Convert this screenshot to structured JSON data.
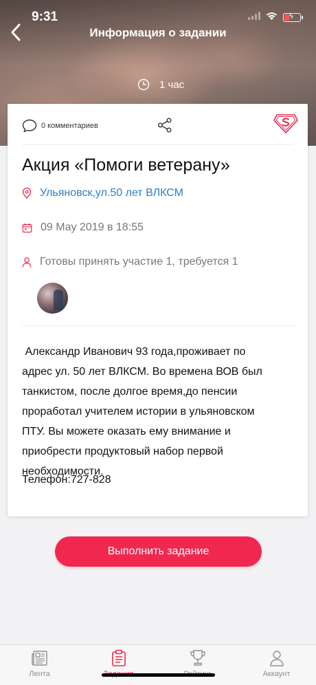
{
  "status": {
    "time": "9:31"
  },
  "header": {
    "title": "Информация о задании"
  },
  "hero": {
    "duration": "1 час"
  },
  "card": {
    "comments_label": "0 комментариев",
    "title": "Акция «Помоги ветерану»",
    "location": "Ульяновск,ул.50 лет ВЛКСМ",
    "date": "09 May 2019 в 18:55",
    "participants": "Готовы принять участие 1, требуется 1",
    "description": " Александр Иванович 93 года,проживает по\nадрес ул. 50 лет ВЛКСМ. Во времена ВОВ был\nтанкистом, после долгое время,до пенсии\nпроработал учителем истории в ульяновском\nПТУ. Вы можете оказать ему внимание и\nприобрести продуктовый набор первой\nнеобходимости.",
    "phone": "Телефон:727-828"
  },
  "action": {
    "label": "Выполнить задание"
  },
  "tabbar": {
    "tabs": [
      {
        "label": "Лента",
        "icon": "newspaper-icon",
        "active": false
      },
      {
        "label": "Задания",
        "icon": "clipboard-icon",
        "active": true
      },
      {
        "label": "Рейтинг",
        "icon": "trophy-icon",
        "active": false
      },
      {
        "label": "Аккаунт",
        "icon": "user-icon",
        "active": false
      }
    ]
  },
  "colors": {
    "accent": "#f0284f",
    "link": "#2b7fc5",
    "muted": "#777777"
  }
}
